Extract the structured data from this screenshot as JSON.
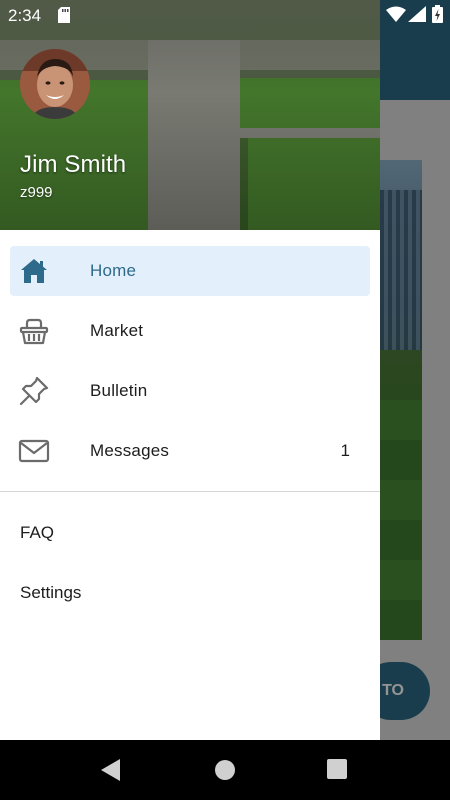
{
  "status_bar": {
    "time": "2:34",
    "icons": [
      "sd-card-icon",
      "wifi-icon",
      "signal-icon",
      "battery-charging-icon"
    ]
  },
  "background_app": {
    "fab_label": "TO",
    "accent_color": "#2d6a86"
  },
  "drawer": {
    "user": {
      "name": "Jim Smith",
      "id": "z999",
      "avatar": "profile-photo"
    },
    "menu_items": [
      {
        "label": "Home",
        "icon": "home-icon",
        "active": true
      },
      {
        "label": "Market",
        "icon": "basket-icon",
        "active": false
      },
      {
        "label": "Bulletin",
        "icon": "pushpin-icon",
        "active": false
      },
      {
        "label": "Messages",
        "icon": "envelope-icon",
        "active": false,
        "badge": "1"
      }
    ],
    "secondary_items": [
      {
        "label": "FAQ"
      },
      {
        "label": "Settings"
      }
    ],
    "colors": {
      "active_background": "#e3f0fb",
      "active_text": "#2e6a8a",
      "icon_gray": "#6b6b6b"
    }
  },
  "nav_bar": {
    "buttons": [
      "back-icon",
      "home-circle-icon",
      "recents-icon"
    ]
  }
}
